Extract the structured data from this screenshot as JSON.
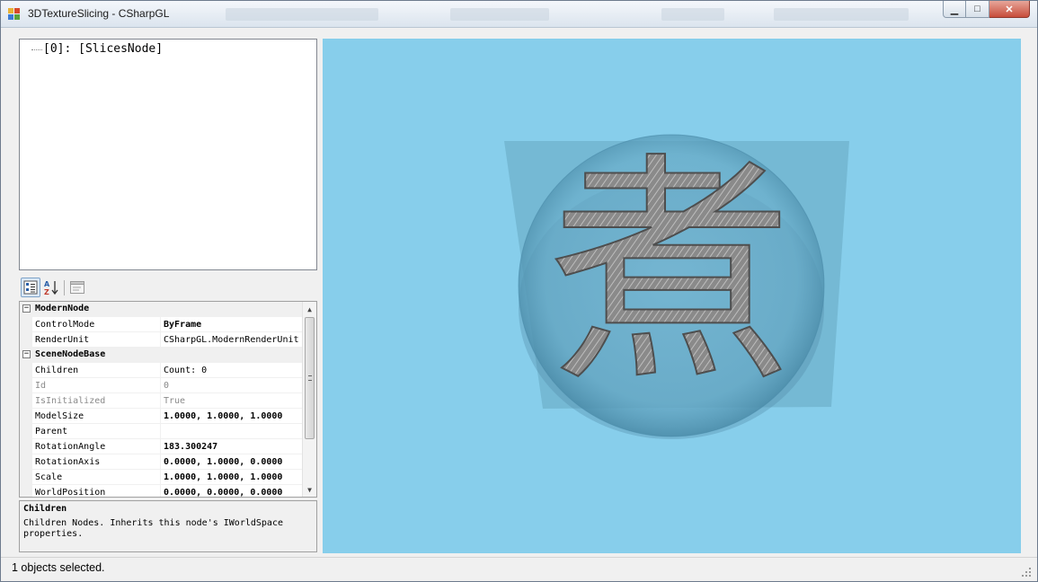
{
  "window": {
    "title": "3DTextureSlicing - CSharpGL",
    "buttons": {
      "minimize": "▁",
      "maximize": "□",
      "close": "✕"
    }
  },
  "tree": {
    "nodes": [
      {
        "label": "[0]: [SlicesNode]"
      }
    ]
  },
  "toolbar": {
    "buttons": [
      {
        "name": "categorized-view",
        "icon": "categorized-icon",
        "active": true
      },
      {
        "name": "alphabetical-view",
        "icon": "sort-az-icon",
        "active": false
      },
      {
        "name": "property-pages",
        "icon": "property-pages-icon",
        "active": false
      }
    ]
  },
  "property_grid": {
    "categories": [
      {
        "label": "ModernNode",
        "properties": [
          {
            "name": "ControlMode",
            "value": "ByFrame",
            "bold": true,
            "readonly": false
          },
          {
            "name": "RenderUnit",
            "value": "CSharpGL.ModernRenderUnit",
            "bold": false,
            "readonly": false
          }
        ]
      },
      {
        "label": "SceneNodeBase",
        "properties": [
          {
            "name": "Children",
            "value": "Count: 0",
            "bold": false,
            "readonly": false
          },
          {
            "name": "Id",
            "value": "0",
            "bold": false,
            "readonly": true
          },
          {
            "name": "IsInitialized",
            "value": "True",
            "bold": false,
            "readonly": true
          },
          {
            "name": "ModelSize",
            "value": "1.0000, 1.0000, 1.0000",
            "bold": true,
            "readonly": false
          },
          {
            "name": "Parent",
            "value": "",
            "bold": false,
            "readonly": false
          },
          {
            "name": "RotationAngle",
            "value": "183.300247",
            "bold": true,
            "readonly": false
          },
          {
            "name": "RotationAxis",
            "value": "0.0000, 1.0000, 0.0000",
            "bold": true,
            "readonly": false
          },
          {
            "name": "Scale",
            "value": "1.0000, 1.0000, 1.0000",
            "bold": true,
            "readonly": false
          },
          {
            "name": "WorldPosition",
            "value": "0.0000, 0.0000, 0.0000",
            "bold": true,
            "readonly": false
          }
        ]
      }
    ]
  },
  "help": {
    "title": "Children",
    "description": "Children Nodes. Inherits this node's IWorldSpace properties."
  },
  "canvas": {
    "background": "#87ceeb",
    "glyph": "煮"
  },
  "status": {
    "text": "1 objects selected."
  },
  "colors": {
    "accent": "#3399ff",
    "canvas": "#87ceeb",
    "slab": "#5f9fb8",
    "glyph": "#7a7a7a"
  }
}
